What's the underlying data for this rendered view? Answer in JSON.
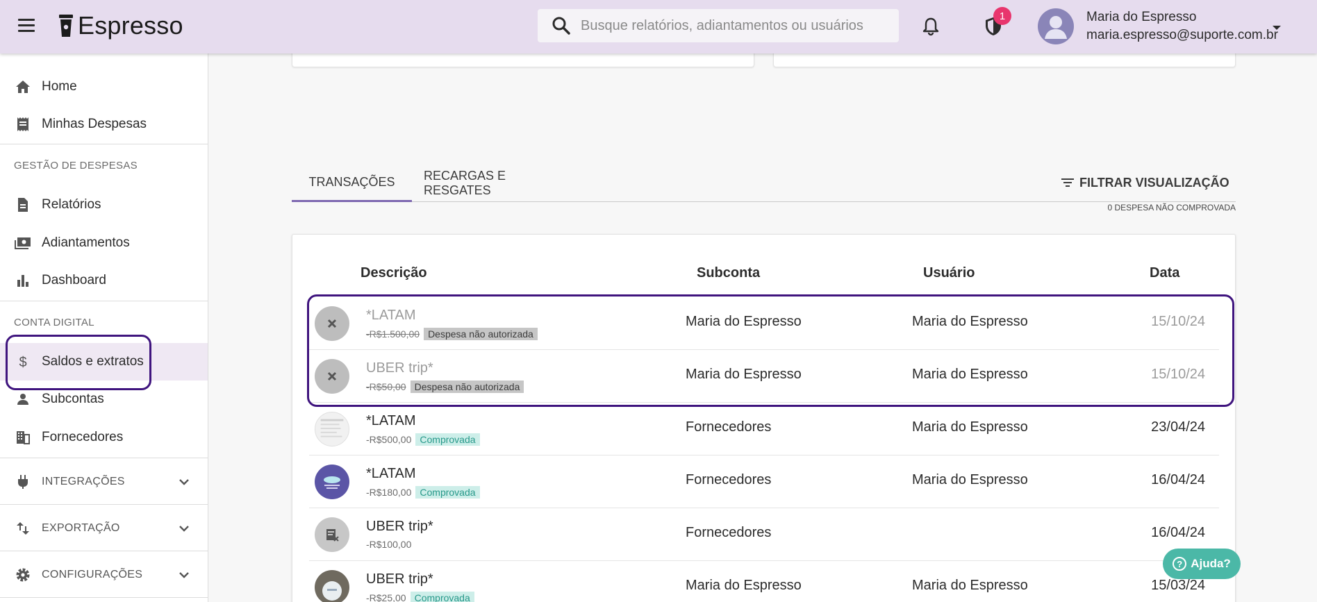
{
  "app": {
    "name": "Espresso"
  },
  "search": {
    "placeholder": "Busque relatórios, adiantamentos ou usuários"
  },
  "header": {
    "notifications_badge": "1",
    "user_name": "Maria do Espresso",
    "user_email": "maria.espresso@suporte.com.br"
  },
  "sidebar": {
    "home": "Home",
    "my_expenses": "Minhas Despesas",
    "section_expense_mgmt": "GESTÃO DE DESPESAS",
    "reports": "Relatórios",
    "advances": "Adiantamentos",
    "dashboard": "Dashboard",
    "section_digital_account": "CONTA DIGITAL",
    "balances": "Saldos e extratos",
    "subaccounts": "Subcontas",
    "suppliers": "Fornecedores",
    "integrations": "INTEGRAÇÕES",
    "export": "EXPORTAÇÃO",
    "settings": "CONFIGURAÇÕES"
  },
  "tabs": {
    "transactions": "TRANSAÇÕES",
    "recharges": "RECARGAS E RESGATES"
  },
  "filter": {
    "label": "FILTRAR VISUALIZAÇÃO"
  },
  "unproven_count": "0 DESPESA NÃO COMPROVADA",
  "table": {
    "headers": {
      "description": "Descrição",
      "subaccount": "Subconta",
      "user": "Usuário",
      "date": "Data"
    },
    "rows": [
      {
        "description": "*LATAM",
        "amount": "-R$1.500,00",
        "status": "Despesa não autorizada",
        "subaccount": "Maria do Espresso",
        "user": "Maria do Espresso",
        "date": "15/10/24"
      },
      {
        "description": "UBER trip*",
        "amount": "-R$50,00",
        "status": "Despesa não autorizada",
        "subaccount": "Maria do Espresso",
        "user": "Maria do Espresso",
        "date": "15/10/24"
      },
      {
        "description": "*LATAM",
        "amount": "-R$500,00",
        "status": "Comprovada",
        "subaccount": "Fornecedores",
        "user": "Maria do Espresso",
        "date": "23/04/24"
      },
      {
        "description": "*LATAM",
        "amount": "-R$180,00",
        "status": "Comprovada",
        "subaccount": "Fornecedores",
        "user": "Maria do Espresso",
        "date": "16/04/24"
      },
      {
        "description": "UBER trip*",
        "amount": "-R$100,00",
        "status": "",
        "subaccount": "Fornecedores",
        "user": "",
        "date": "16/04/24"
      },
      {
        "description": "UBER trip*",
        "amount": "-R$25,00",
        "status": "Comprovada",
        "subaccount": "Maria do Espresso",
        "user": "Maria do Espresso",
        "date": "15/03/24"
      }
    ]
  },
  "help": {
    "label": "Ajuda?"
  },
  "colors": {
    "topbar": "#e6dcee",
    "accent": "#3f147e",
    "tab_indicator": "#7d67b0",
    "ok_tag": "#cdeee9",
    "help": "#4bb8a7",
    "badge": "#e8356d"
  }
}
